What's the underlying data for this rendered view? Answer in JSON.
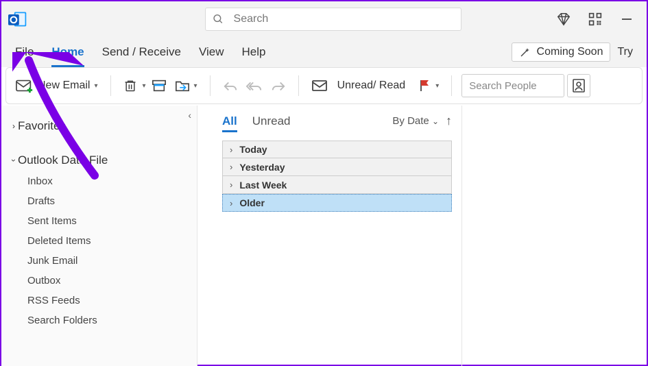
{
  "titlebar": {
    "search_placeholder": "Search"
  },
  "tabs": {
    "items": [
      "File",
      "Home",
      "Send / Receive",
      "View",
      "Help"
    ],
    "active_index": 1,
    "coming_soon": "Coming Soon",
    "try": "Try"
  },
  "ribbon": {
    "new_email": "New Email",
    "unread_read": "Unread/ Read",
    "search_people_placeholder": "Search People"
  },
  "nav": {
    "favorites": "Favorites",
    "data_file": "Outlook Data File",
    "folders": [
      "Inbox",
      "Drafts",
      "Sent Items",
      "Deleted Items",
      "Junk Email",
      "Outbox",
      "RSS Feeds",
      "Search Folders"
    ]
  },
  "list": {
    "filters": [
      "All",
      "Unread"
    ],
    "active_filter": 0,
    "sort_label": "By Date",
    "groups": [
      "Today",
      "Yesterday",
      "Last Week",
      "Older"
    ],
    "selected_group": 3
  }
}
